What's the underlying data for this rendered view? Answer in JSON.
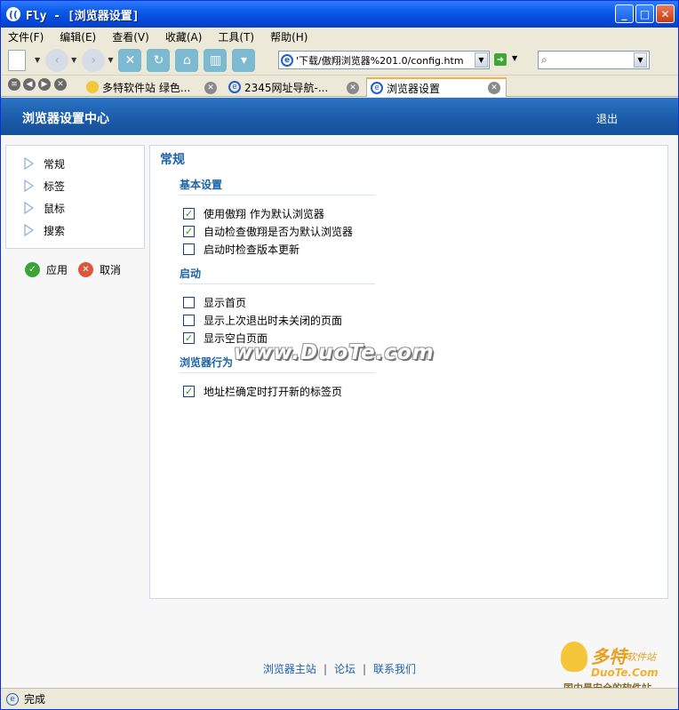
{
  "window": {
    "title": "Fly - [浏览器设置]",
    "logo": "(("
  },
  "menu": [
    "文件(F)",
    "编辑(E)",
    "查看(V)",
    "收藏(A)",
    "工具(T)",
    "帮助(H)"
  ],
  "toolbar": {
    "icons": [
      "new-page-icon",
      "back-icon",
      "forward-icon",
      "stop-icon",
      "refresh-icon",
      "home-icon",
      "split-view-icon",
      "tabs-icon"
    ]
  },
  "address": {
    "value": "'下载/傲翔浏览器%201.0/config.htm"
  },
  "search": {
    "value": ""
  },
  "tabs": [
    {
      "label": "多特软件站 绿色..."
    },
    {
      "label": "2345网址导航-..."
    },
    {
      "label": "浏览器设置"
    }
  ],
  "page": {
    "header_title": "浏览器设置中心",
    "logout": "退出",
    "nav": [
      "常规",
      "标签",
      "鼠标",
      "搜索"
    ],
    "apply": "应用",
    "cancel": "取消",
    "section_title": "常规",
    "groups": [
      {
        "title": "基本设置",
        "options": [
          {
            "label": "使用傲翔 作为默认浏览器",
            "checked": true
          },
          {
            "label": "自动检查傲翔是否为默认浏览器",
            "checked": true
          },
          {
            "label": "启动时检查版本更新",
            "checked": false
          }
        ]
      },
      {
        "title": "启动",
        "options": [
          {
            "label": "显示首页",
            "checked": false
          },
          {
            "label": "显示上次退出时未关闭的页面",
            "checked": false
          },
          {
            "label": "显示空白页面",
            "checked": true
          }
        ]
      },
      {
        "title": "浏览器行为",
        "options": [
          {
            "label": "地址栏确定时打开新的标签页",
            "checked": true
          }
        ]
      }
    ],
    "footer": [
      "浏览器主站",
      "论坛",
      "联系我们"
    ],
    "watermark": "www.DuoTe.com",
    "brand_watermark": {
      "name": "多特",
      "sub": "软件站",
      "url": "DuoTe.Com",
      "tagline": "国内最安全的软件站"
    }
  },
  "status": {
    "text": "完成"
  },
  "colors": {
    "accent": "#1c62a8",
    "header": "#1a5aa8",
    "check": "#21a121"
  }
}
